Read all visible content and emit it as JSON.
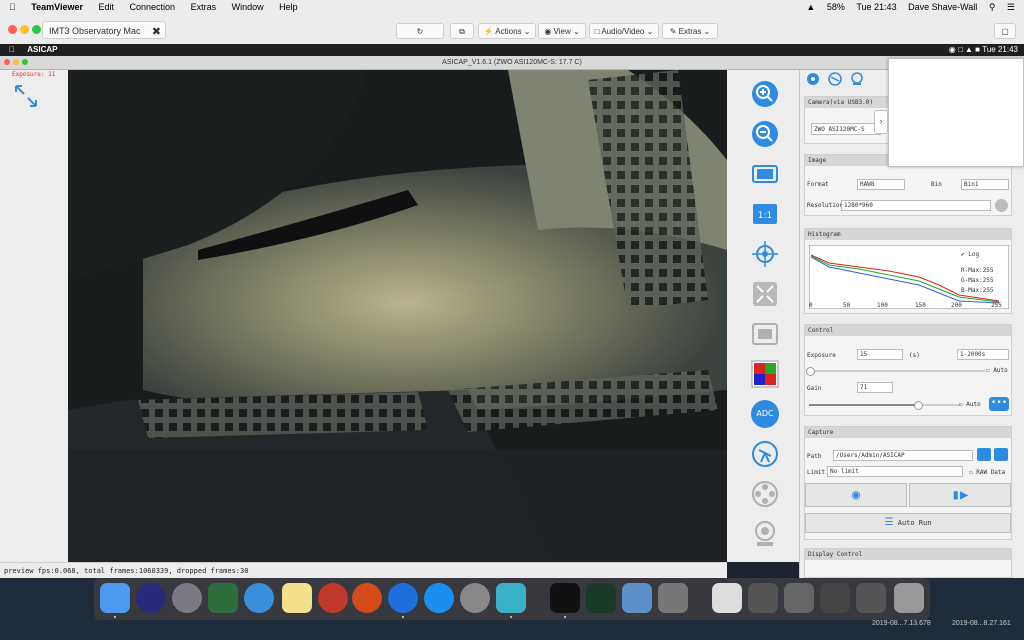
{
  "host_menubar": {
    "app": "TeamViewer",
    "items": [
      "Edit",
      "Connection",
      "Extras",
      "Window",
      "Help"
    ],
    "battery": "58%",
    "clock": "Tue 21:43",
    "user": "Dave Shave-Wall"
  },
  "tv_toolbar": {
    "tab_label": "IMT3 Observatory Mac",
    "actions_label": "Actions",
    "view_label": "View",
    "audio_label": "Audio/Video",
    "extras_label": "Extras"
  },
  "remote_menubar": {
    "app": "ASICAP",
    "clock": "Tue 21:43"
  },
  "window": {
    "title": "ASICAP_V1.6.1 (ZWO ASI120MC-S: 17.7 C)"
  },
  "left_panel": {
    "exposure_label": "Exposure: 11"
  },
  "camera_section": {
    "title": "Camera(via USB3.0)",
    "camera_name": "ZWO ASI120MC-S"
  },
  "image_section": {
    "title": "Image",
    "format_label": "Format",
    "format_value": "RAW8",
    "bin_label": "Bin",
    "bin_value": "Bin1",
    "resolution_label": "Resolution",
    "resolution_value": "1280*960"
  },
  "histogram_section": {
    "title": "Histogram",
    "log_label": "Log",
    "r_max": "R-Max:255",
    "g_max": "G-Max:255",
    "b_max": "B-Max:255",
    "ticks": [
      "0",
      "50",
      "100",
      "150",
      "200",
      "255"
    ]
  },
  "control_section": {
    "title": "Control",
    "exposure_label": "Exposure",
    "exposure_value": "15",
    "exposure_unit": "(s)",
    "exposure_range": "1-2000s",
    "exposure_auto_label": "Auto",
    "gain_label": "Gain",
    "gain_value": "71",
    "gain_auto_label": "Auto",
    "gain_slider_level": 0.71
  },
  "capture_section": {
    "title": "Capture",
    "path_label": "Path",
    "path_value": "/Users/Admin/ASICAP",
    "limit_label": "Limit",
    "limit_value": "No limit",
    "raw_label": "RAW Data",
    "auto_run_label": "Auto Run"
  },
  "display_section": {
    "title": "Display Control"
  },
  "status_bar": {
    "text": "preview fps:0.068, total frames:1060339, dropped frames:30"
  },
  "tools": [
    {
      "name": "zoom-in-icon"
    },
    {
      "name": "zoom-out-icon"
    },
    {
      "name": "fit-screen-icon"
    },
    {
      "name": "actual-size-icon"
    },
    {
      "name": "crosshair-icon"
    },
    {
      "name": "fullscreen-icon"
    },
    {
      "name": "frame-icon"
    },
    {
      "name": "color-balance-icon"
    },
    {
      "name": "adc-icon",
      "label": "ADC"
    },
    {
      "name": "telescope-icon"
    },
    {
      "name": "filter-wheel-icon"
    },
    {
      "name": "focuser-icon"
    }
  ],
  "dock": {
    "labels": [
      "2019-08...7.13.678",
      "2019-08...8.27.161"
    ]
  },
  "colors": {
    "accent": "#3a8fdc",
    "tool_blue": "#2f8be0"
  }
}
